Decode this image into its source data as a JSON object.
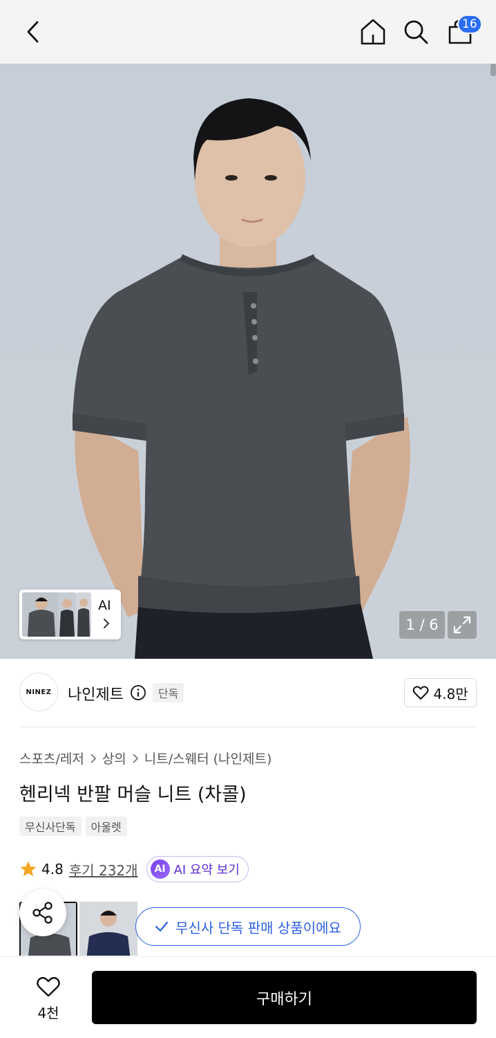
{
  "header": {
    "cart_count": "16",
    "icons": [
      "back-icon",
      "home-icon",
      "search-icon",
      "cart-icon"
    ]
  },
  "hero": {
    "counter": "1 / 6",
    "thumb_strip_label": "AI"
  },
  "brand": {
    "logo_text": "NINEZ",
    "name": "나인제트",
    "exclusive_label": "단독",
    "likes": "4.8만"
  },
  "breadcrumb": [
    "스포츠/레저",
    "상의",
    "니트/스웨터 (나인제트)"
  ],
  "product": {
    "title": "헨리넥 반팔 머슬 니트 (차콜)",
    "tags": [
      "무신사단독",
      "아울렛"
    ]
  },
  "rating": {
    "value": "4.8",
    "reviews": "후기 232개",
    "ai_badge": "AI",
    "ai_summary_label": "AI 요약 보기"
  },
  "notice": {
    "label": "무신사 단독 판매 상품이에요"
  },
  "bottom": {
    "wish_count": "4천",
    "buy_label": "구매하기"
  },
  "colors": {
    "accent_blue": "#2b6cf6",
    "notice_blue": "#2b5fe0",
    "ai_purple": "#7b3ff2",
    "star": "#f5a623",
    "buy_button": "#000000"
  }
}
